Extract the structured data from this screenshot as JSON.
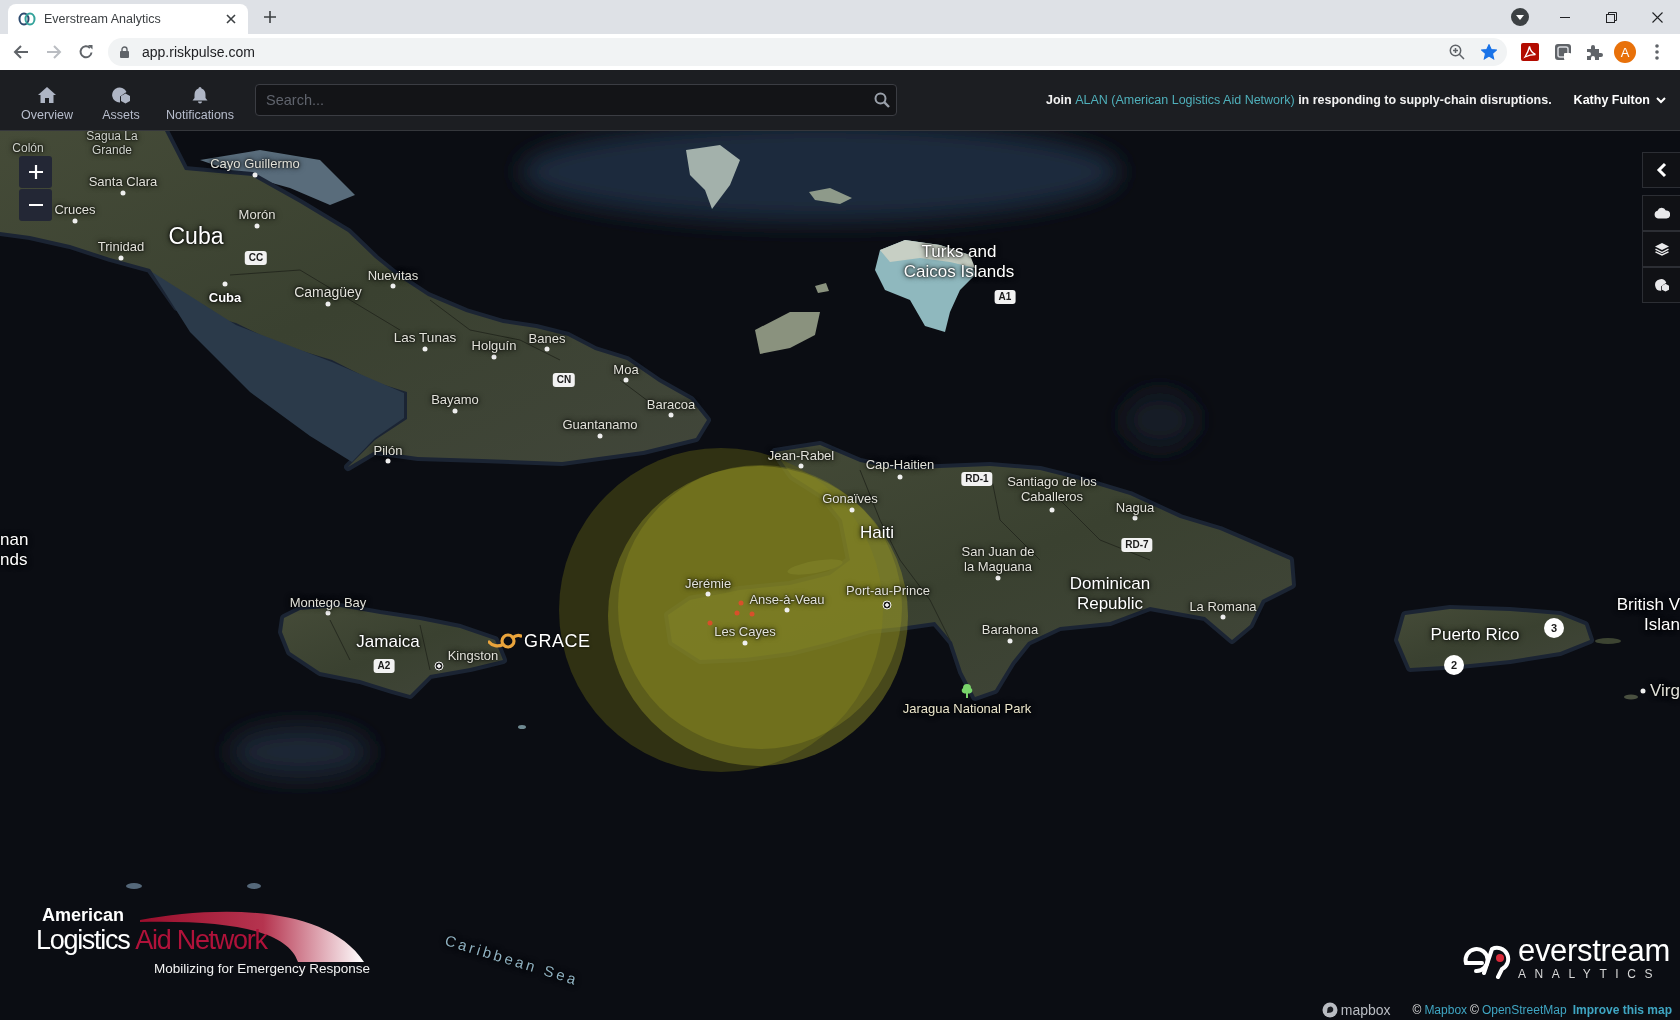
{
  "browser": {
    "tab": {
      "title": "Everstream Analytics"
    },
    "url": "app.riskpulse.com",
    "forward_disabled": true,
    "bookmarked": true,
    "profile_initial": "A"
  },
  "app_header": {
    "nav": [
      {
        "label": "Overview",
        "kind": "home"
      },
      {
        "label": "Assets",
        "kind": "assets"
      },
      {
        "label": "Notifications",
        "kind": "bell"
      }
    ],
    "search": {
      "placeholder": "Search..."
    },
    "banner": {
      "lead": "Join",
      "link": "ALAN (American Logistics Aid Network)",
      "tail": "in responding to supply-chain disruptions."
    },
    "user": {
      "name": "Kathy Fulton"
    }
  },
  "map": {
    "labels": [
      {
        "text": "Colón",
        "kind": "place"
      },
      {
        "text": "Sagua La\nGrande",
        "kind": "place"
      },
      {
        "text": "Cayo Guillermo",
        "kind": "city"
      },
      {
        "text": "Santa Clara",
        "kind": "city"
      },
      {
        "text": "Cruces",
        "kind": "city"
      },
      {
        "text": "Morón",
        "kind": "city"
      },
      {
        "text": "Cuba",
        "kind": "country"
      },
      {
        "text": "CC",
        "kind": "shield"
      },
      {
        "text": "Trinidad",
        "kind": "city"
      },
      {
        "text": "Cuba",
        "kind": "region"
      },
      {
        "text": "Nuevitas",
        "kind": "city"
      },
      {
        "text": "Camagüey",
        "kind": "city"
      },
      {
        "text": "Las Tunas",
        "kind": "city"
      },
      {
        "text": "Holguín",
        "kind": "city"
      },
      {
        "text": "Banes",
        "kind": "city"
      },
      {
        "text": "CN",
        "kind": "shield"
      },
      {
        "text": "Moa",
        "kind": "city"
      },
      {
        "text": "Baracoa",
        "kind": "city"
      },
      {
        "text": "Bayamo",
        "kind": "city"
      },
      {
        "text": "Guantanamo",
        "kind": "city"
      },
      {
        "text": "Pilón",
        "kind": "city"
      },
      {
        "text": "Turks and\nCaicos Islands",
        "kind": "country"
      },
      {
        "text": "A1",
        "kind": "shield"
      },
      {
        "text": "Jean-Rabel",
        "kind": "city"
      },
      {
        "text": "Cap-Haitien",
        "kind": "city"
      },
      {
        "text": "RD-1",
        "kind": "shield"
      },
      {
        "text": "Gonaïves",
        "kind": "city"
      },
      {
        "text": "Santiago de los\nCaballeros",
        "kind": "city"
      },
      {
        "text": "Nagua",
        "kind": "city"
      },
      {
        "text": "nan\nnds",
        "kind": "country"
      },
      {
        "text": "Haiti",
        "kind": "country"
      },
      {
        "text": "RD-7",
        "kind": "shield"
      },
      {
        "text": "San Juan de\nla Maguana",
        "kind": "city"
      },
      {
        "text": "Jérémie",
        "kind": "city"
      },
      {
        "text": "Montego Bay",
        "kind": "city"
      },
      {
        "text": "Anse-à-Veau",
        "kind": "city"
      },
      {
        "text": "Port-au-Prince",
        "kind": "capital"
      },
      {
        "text": "Dominican\nRepublic",
        "kind": "country"
      },
      {
        "text": "La Romana",
        "kind": "city"
      },
      {
        "text": "British V\nIslan",
        "kind": "country"
      },
      {
        "text": "Jamaica",
        "kind": "country"
      },
      {
        "text": "Les Cayes",
        "kind": "city"
      },
      {
        "text": "Barahona",
        "kind": "city"
      },
      {
        "text": "Puerto Rico",
        "kind": "country"
      },
      {
        "text": "A2",
        "kind": "shield"
      },
      {
        "text": "Kingston",
        "kind": "capital"
      },
      {
        "text": "Jaragua National Park",
        "kind": "park"
      },
      {
        "text": "Virg",
        "kind": "city"
      },
      {
        "text": "Caribbean Sea",
        "kind": "sea"
      }
    ],
    "storm": {
      "name": "GRACE"
    },
    "clusters": [
      {
        "count": "3"
      },
      {
        "count": "2"
      }
    ]
  },
  "alan_logo": {
    "top_line": "American",
    "main_word": "Logistics",
    "accent_words": "Aid Network",
    "tagline": "Mobilizing for Emergency Response"
  },
  "brand_logo": {
    "name": "everstream",
    "subtitle": "ANALYTICS"
  },
  "attribution": {
    "logo_text": "mapbox",
    "credits": [
      {
        "kind": "credit",
        "symbol": "©",
        "link": "Mapbox"
      },
      {
        "kind": "credit",
        "symbol": "©",
        "link": "OpenStreetMap"
      },
      {
        "kind": "action",
        "link": "Improve this map"
      }
    ]
  }
}
